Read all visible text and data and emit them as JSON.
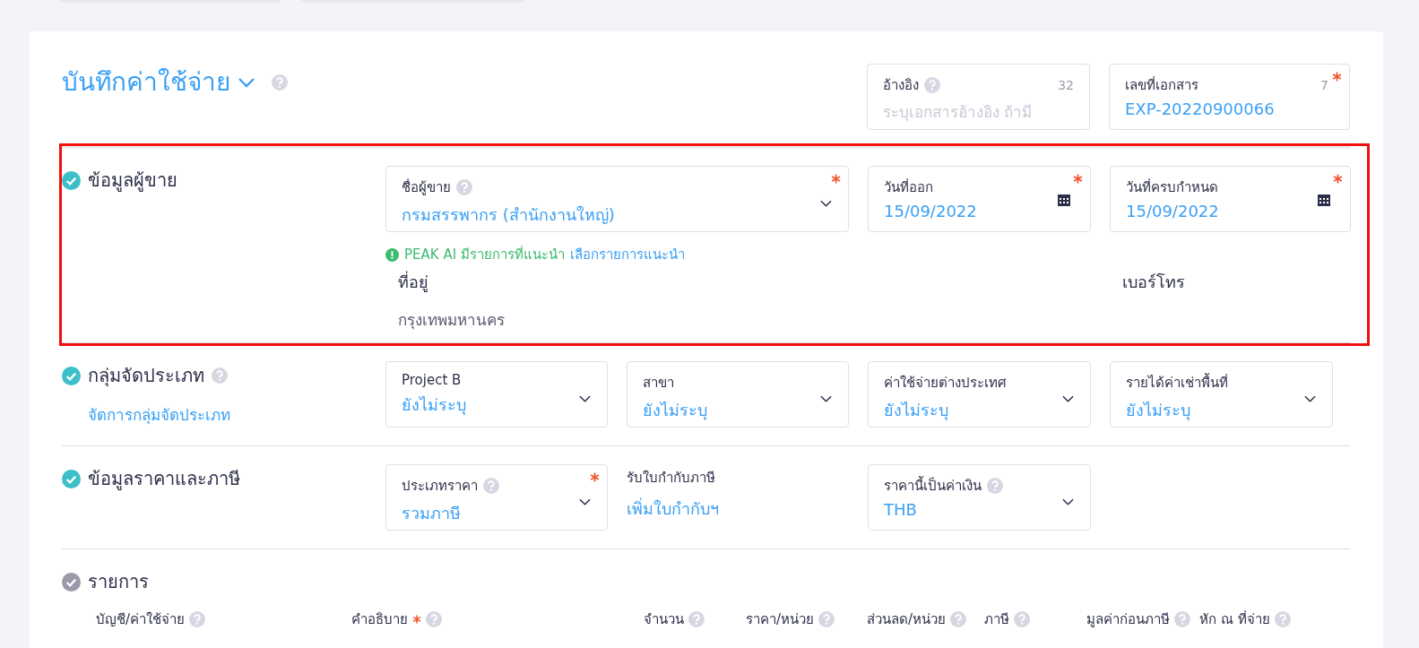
{
  "title": "บันทึกค่าใช้จ่าย",
  "top_fields": [
    {
      "label": "อ้างอิง",
      "help": true,
      "counter": "32",
      "required": false,
      "placeholder": "ระบุเอกสารอ้างอิง ถ้ามี"
    },
    {
      "label": "เลขที่เอกสาร",
      "help": false,
      "counter": "7",
      "required": true,
      "value": "EXP-20220900066"
    }
  ],
  "sections": [
    {
      "kind": "vendor",
      "title": "ข้อมูลผู้ขาย",
      "done": true,
      "help": false,
      "highlighted": true,
      "fields": [
        {
          "kind": "select",
          "label": "ชื่อผู้ขาย",
          "help": true,
          "required": true,
          "value": "กรมสรรพากร (สำนักงานใหญ่)"
        },
        {
          "kind": "date",
          "label": "วันที่ออก",
          "help": false,
          "required": true,
          "value": "15/09/2022"
        },
        {
          "kind": "date",
          "label": "วันที่ครบกำหนด",
          "help": false,
          "required": true,
          "value": "15/09/2022"
        }
      ],
      "ai_hint": {
        "text": "PEAK AI มีรายการที่แนะนำ",
        "link": "เลือกรายการแนะนำ"
      },
      "address": {
        "label": "ที่อยู่",
        "value": "กรุงเทพมหานคร"
      },
      "phone": {
        "label": "เบอร์โทร"
      }
    },
    {
      "kind": "category",
      "title": "กลุ่มจัดประเภท",
      "done": true,
      "help": true,
      "highlighted": false,
      "link": "จัดการกลุ่มจัดประเภท",
      "fields": [
        {
          "kind": "select",
          "label": "Project B",
          "help": false,
          "required": false,
          "value": "ยังไม่ระบุ"
        },
        {
          "kind": "select",
          "label": "สาขา",
          "help": false,
          "required": false,
          "value": "ยังไม่ระบุ"
        },
        {
          "kind": "select",
          "label": "ค่าใช้จ่ายต่างประเทศ",
          "help": false,
          "required": false,
          "value": "ยังไม่ระบุ"
        },
        {
          "kind": "select",
          "label": "รายได้ค่าเช่าพื้นที่",
          "help": false,
          "required": false,
          "value": "ยังไม่ระบุ"
        }
      ]
    },
    {
      "kind": "pricing",
      "title": "ข้อมูลราคาและภาษี",
      "done": true,
      "help": false,
      "highlighted": false,
      "fields": [
        {
          "kind": "select",
          "label": "ประเภทราคา",
          "help": true,
          "required": true,
          "value": "รวมภาษี"
        },
        {
          "kind": "link",
          "label": "รับใบกำกับภาษี",
          "help": false,
          "required": false,
          "value": "เพิ่มใบกำกับฯ"
        },
        {
          "kind": "select",
          "label": "ราคานี้เป็นค่าเงิน",
          "help": true,
          "required": false,
          "value": "THB"
        }
      ]
    },
    {
      "kind": "items",
      "title": "รายการ",
      "done": false,
      "help": false,
      "highlighted": false,
      "columns": [
        {
          "label": "บัญชี/ค่าใช้จ่าย",
          "required": false,
          "help": true
        },
        {
          "label": "คำอธิบาย",
          "required": true,
          "help": true
        },
        {
          "label": "จำนวน",
          "required": false,
          "help": true
        },
        {
          "label": "ราคา/หน่วย",
          "required": false,
          "help": true
        },
        {
          "label": "ส่วนลด/หน่วย",
          "required": false,
          "help": true
        },
        {
          "label": "ภาษี",
          "required": false,
          "help": true
        },
        {
          "label": "มูลค่าก่อนภาษี",
          "required": false,
          "help": true
        },
        {
          "label": "หัก ณ ที่จ่าย",
          "required": false,
          "help": true
        }
      ]
    }
  ]
}
